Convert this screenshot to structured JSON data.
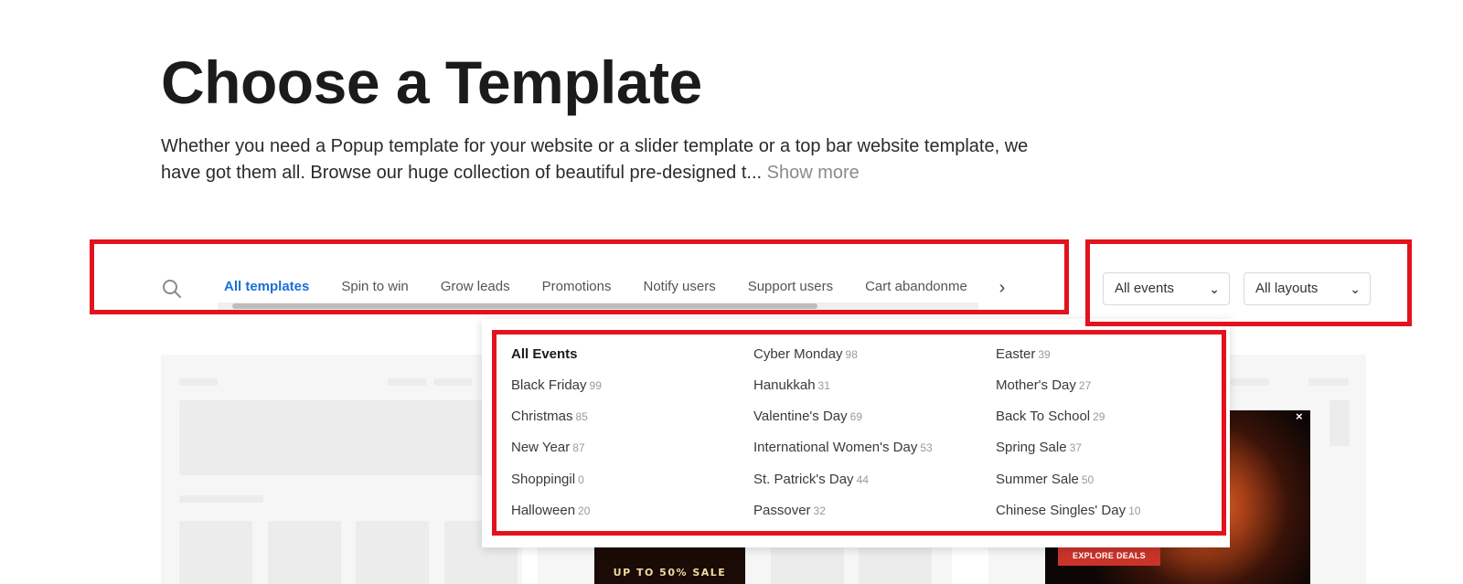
{
  "header": {
    "title": "Choose a Template",
    "description": "Whether you need a Popup template for your website or a slider template or a top bar website template, we have got them all. Browse our huge collection of beautiful pre-designed t...",
    "show_more": "Show more"
  },
  "filters": {
    "tabs": [
      "All templates",
      "Spin to win",
      "Grow leads",
      "Promotions",
      "Notify users",
      "Support users",
      "Cart abandonme"
    ],
    "active_tab": "All templates",
    "events_select": "All events",
    "layouts_select": "All layouts"
  },
  "events_dropdown": {
    "columns": [
      [
        {
          "label": "All Events",
          "count": ""
        },
        {
          "label": "Black Friday",
          "count": "99"
        },
        {
          "label": "Christmas",
          "count": "85"
        },
        {
          "label": "New Year",
          "count": "87"
        },
        {
          "label": "Shoppingil",
          "count": "0"
        },
        {
          "label": "Halloween",
          "count": "20"
        }
      ],
      [
        {
          "label": "Cyber Monday",
          "count": "98"
        },
        {
          "label": "Hanukkah",
          "count": "31"
        },
        {
          "label": "Valentine's Day",
          "count": "69"
        },
        {
          "label": "International Women's Day",
          "count": "53"
        },
        {
          "label": "St. Patrick's Day",
          "count": "44"
        },
        {
          "label": "Passover",
          "count": "32"
        }
      ],
      [
        {
          "label": "Easter",
          "count": "39"
        },
        {
          "label": "Mother's Day",
          "count": "27"
        },
        {
          "label": "Back To School",
          "count": "29"
        },
        {
          "label": "Spring Sale",
          "count": "37"
        },
        {
          "label": "Summer Sale",
          "count": "50"
        },
        {
          "label": "Chinese Singles' Day",
          "count": "10"
        }
      ]
    ]
  },
  "background_cards": {
    "promo_left_text": "UP TO 50% SALE",
    "promo_right_button": "EXPLORE DEALS",
    "close_symbol": "×"
  },
  "icons": {
    "search": "search-icon",
    "next": "chevron-right-icon",
    "select_chevron": "chevron-down-icon"
  },
  "colors": {
    "accent": "#1a6fd6",
    "highlight": "#e3121e"
  }
}
